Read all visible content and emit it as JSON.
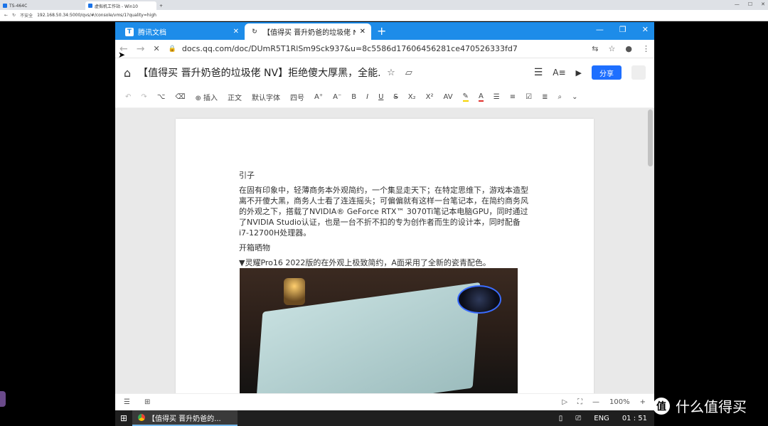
{
  "outer": {
    "tabs": [
      {
        "label": "TS-464C"
      },
      {
        "label": "虚拟机工作站 - Win10"
      }
    ],
    "not_secure": "不安全",
    "url": "192.168.50.34:5000/qvs/#/console/vms/1?quality=high",
    "new_tab": "+",
    "winctrl": {
      "min": "—",
      "max": "☐",
      "close": "✕"
    }
  },
  "vm": {
    "tabs": [
      {
        "label": "腾讯文档",
        "fav": "T",
        "close": "✕"
      },
      {
        "label": "【值得买 晋升奶爸的垃圾佬 NV】",
        "fav": "↻",
        "close": "✕"
      }
    ],
    "new_tab": "+",
    "winbtns": {
      "min": "—",
      "max": "❐",
      "close": "✕"
    },
    "address": {
      "back": "←",
      "forward": "→",
      "reload": "✕",
      "lock": "🔒",
      "url": "docs.qq.com/doc/DUmR5T1RlSm9Sck937&u=8c5586d17606456281ce470526333fd7",
      "translate": "⇆",
      "star": "☆",
      "profile": "●",
      "menu": "⋮"
    },
    "doc": {
      "home": "⌂",
      "title": "【值得买 晋升奶爸的垃圾佬 NV】拒绝傻大厚黑，全能...",
      "star": "☆",
      "tag": "▱",
      "menu": "☰",
      "font": "A≡",
      "present": "▶",
      "share": "分享"
    },
    "toolbar": {
      "undo": "↶",
      "redo": "↷",
      "paint": "⌥",
      "eraser": "⌫",
      "insert": "⊕ 插入",
      "style": "正文",
      "font": "默认字体",
      "size": "四号",
      "bigger": "A⁺",
      "smaller": "A⁻",
      "bold": "B",
      "italic": "I",
      "underline": "U",
      "strike": "S",
      "sub": "X₂",
      "sup": "X²",
      "spacing": "AV",
      "highlight": "✎",
      "color": "A",
      "list": "☰",
      "numlist": "≡",
      "check": "☑",
      "align": "≣",
      "search": "⌕",
      "more": "⌄"
    },
    "content": {
      "heading": "引子",
      "para1": "在固有印象中，轻薄商务本外观简约，一个集显走天下；在特定思维下，游戏本造型离不开傻大黑，商务人士看了连连摇头；可偏偏就有这样一台笔记本，在简约商务风的外观之下，搭载了NVIDIA® GeForce RTX™ 3070Ti笔记本电脑GPU，同时通过了NVIDIA Studio认证，也是一台不折不扣的专为创作者而生的设计本，同时配备i7-12700H处理器。",
      "heading2": "开箱晒物",
      "caption": "▼灵耀Pro16 2022版的在外观上极致简约，A面采用了全新的瓷青配色。"
    },
    "status": {
      "outline": "☰",
      "ruler": "⊞",
      "play": "▷",
      "fit": "⛶",
      "zoom_out": "—",
      "zoom": "100%",
      "zoom_in": "+"
    }
  },
  "taskbar": {
    "start": "⊞",
    "item": "【值得买 晋升奶爸的...",
    "tray": {
      "usb": "▯",
      "net": "⎚",
      "lang": "ENG",
      "time": "01 : 51"
    }
  },
  "watermark": {
    "icon": "值",
    "text": "什么值得买"
  }
}
